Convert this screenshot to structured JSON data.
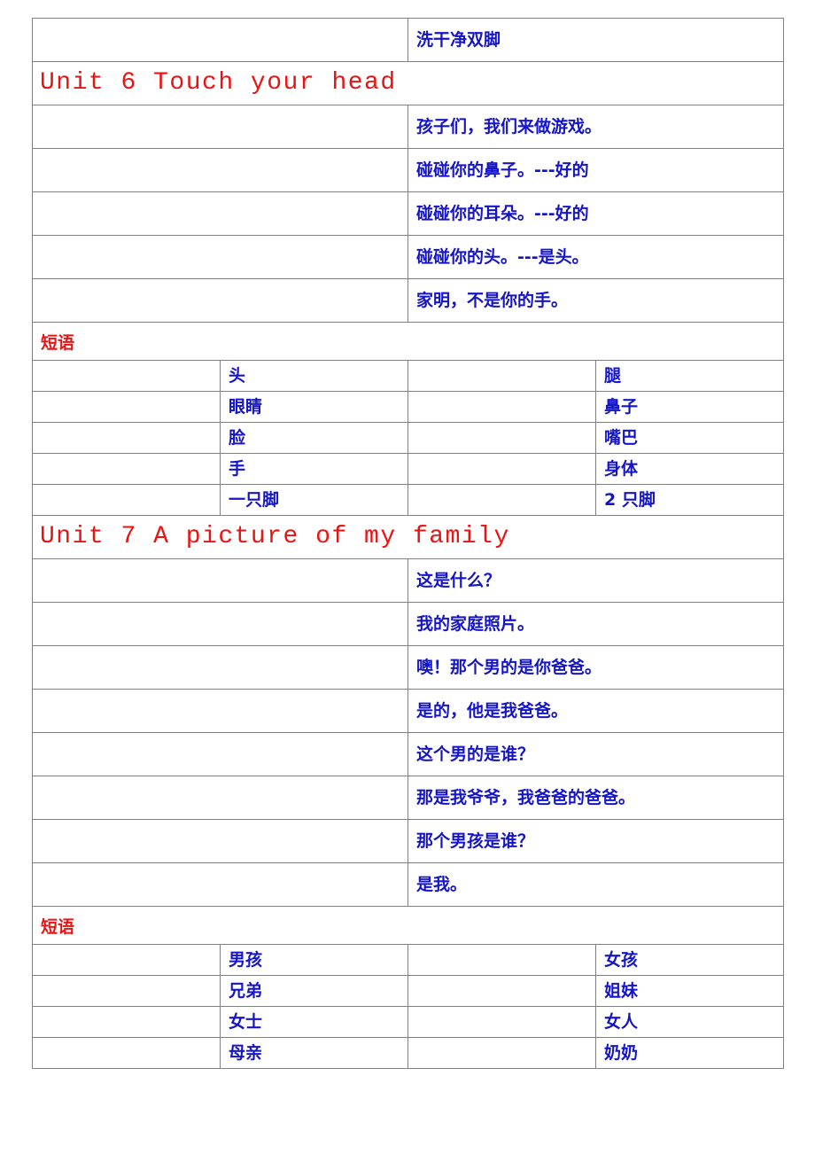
{
  "document": {
    "text_colors": {
      "chinese": "#1414c8",
      "heading": "#e81414",
      "border": "#808080"
    },
    "sections": [
      {
        "type": "sentence_row",
        "blank": "",
        "text": "洗干净双脚"
      },
      {
        "type": "unit_title",
        "text": "Unit 6 Touch your head"
      },
      {
        "type": "sentence_row",
        "blank": "",
        "text": "孩子们，我们来做游戏。"
      },
      {
        "type": "sentence_row",
        "blank": "",
        "text": "碰碰你的鼻子。---好的"
      },
      {
        "type": "sentence_row",
        "blank": "",
        "text": "碰碰你的耳朵。---好的"
      },
      {
        "type": "sentence_row",
        "blank": "",
        "text": "碰碰你的头。---是头。"
      },
      {
        "type": "sentence_row",
        "blank": "",
        "text": "家明，不是你的手。"
      },
      {
        "type": "section_label",
        "text": "短语"
      },
      {
        "type": "phrase_row",
        "blank_left": "",
        "left": "头",
        "blank_right": "",
        "right": "腿"
      },
      {
        "type": "phrase_row",
        "blank_left": "",
        "left": "眼睛",
        "blank_right": "",
        "right": "鼻子"
      },
      {
        "type": "phrase_row",
        "blank_left": "",
        "left": "脸",
        "blank_right": "",
        "right": "嘴巴"
      },
      {
        "type": "phrase_row",
        "blank_left": "",
        "left": "手",
        "blank_right": "",
        "right": "身体"
      },
      {
        "type": "phrase_row",
        "blank_left": "",
        "left": "一只脚",
        "blank_right": "",
        "right": "2 只脚"
      },
      {
        "type": "unit_title",
        "text": "Unit 7 A picture of my family"
      },
      {
        "type": "sentence_row",
        "blank": "",
        "text": "这是什么？"
      },
      {
        "type": "sentence_row",
        "blank": "",
        "text": "我的家庭照片。"
      },
      {
        "type": "sentence_row",
        "blank": "",
        "text": "噢！那个男的是你爸爸。"
      },
      {
        "type": "sentence_row",
        "blank": "",
        "text": "是的，他是我爸爸。"
      },
      {
        "type": "sentence_row",
        "blank": "",
        "text": "这个男的是谁？"
      },
      {
        "type": "sentence_row",
        "blank": "",
        "text": "那是我爷爷，我爸爸的爸爸。"
      },
      {
        "type": "sentence_row",
        "blank": "",
        "text": "那个男孩是谁？"
      },
      {
        "type": "sentence_row",
        "blank": "",
        "text": "是我。"
      },
      {
        "type": "section_label",
        "text": "短语"
      },
      {
        "type": "phrase_row",
        "blank_left": "",
        "left": "男孩",
        "blank_right": "",
        "right": "女孩"
      },
      {
        "type": "phrase_row",
        "blank_left": "",
        "left": "兄弟",
        "blank_right": "",
        "right": "姐妹"
      },
      {
        "type": "phrase_row",
        "blank_left": "",
        "left": "女士",
        "blank_right": "",
        "right": "女人"
      },
      {
        "type": "phrase_row",
        "blank_left": "",
        "left": "母亲",
        "blank_right": "",
        "right": "奶奶"
      }
    ]
  }
}
